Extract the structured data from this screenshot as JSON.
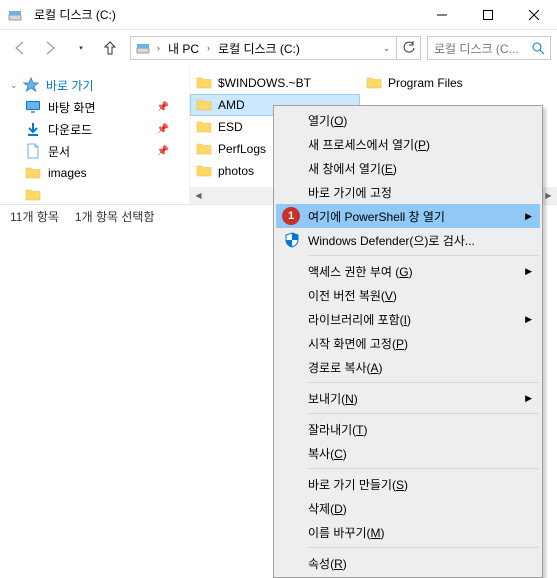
{
  "window": {
    "title": "로컬 디스크 (C:)"
  },
  "address": {
    "segment1": "내 PC",
    "segment2": "로컬 디스크 (C:)"
  },
  "search": {
    "placeholder": "로컬 디스크 (C..."
  },
  "sidebar": {
    "quick_access": "바로 가기",
    "items": [
      {
        "label": "바탕 화면",
        "pinned": true,
        "icon": "desktop"
      },
      {
        "label": "다운로드",
        "pinned": true,
        "icon": "downloads"
      },
      {
        "label": "문서",
        "pinned": true,
        "icon": "documents"
      },
      {
        "label": "images",
        "pinned": false,
        "icon": "folder"
      },
      {
        "label": "",
        "pinned": false,
        "icon": "folder"
      }
    ]
  },
  "files": {
    "col1": [
      {
        "name": "$WINDOWS.~BT",
        "selected": false
      },
      {
        "name": "AMD",
        "selected": true
      },
      {
        "name": "ESD",
        "selected": false
      },
      {
        "name": "PerfLogs",
        "selected": false
      },
      {
        "name": "photos",
        "selected": false
      }
    ],
    "col2": [
      {
        "name": "Program Files",
        "selected": false
      }
    ]
  },
  "status": {
    "count": "11개 항목",
    "selected": "1개 항목 선택함"
  },
  "context_menu": {
    "items": [
      {
        "label": "열기",
        "key": "O",
        "type": "item"
      },
      {
        "label": "새 프로세스에서 열기",
        "key": "P",
        "type": "item"
      },
      {
        "label": "새 창에서 열기",
        "key": "E",
        "type": "item"
      },
      {
        "label": "바로 가기에 고정",
        "key": "",
        "type": "item"
      },
      {
        "label": "여기에 PowerShell 창 열기",
        "key": "",
        "type": "item",
        "highlighted": true,
        "badge": "1",
        "submenu": true
      },
      {
        "label": "Windows Defender(으)로 검사...",
        "key": "",
        "type": "item",
        "icon": "shield"
      },
      {
        "type": "sep"
      },
      {
        "label": "액세스 권한 부여 ",
        "key": "G",
        "type": "item",
        "submenu": true
      },
      {
        "label": "이전 버전 복원",
        "key": "V",
        "type": "item"
      },
      {
        "label": "라이브러리에 포함",
        "key": "I",
        "type": "item",
        "submenu": true
      },
      {
        "label": "시작 화면에 고정",
        "key": "P",
        "type": "item"
      },
      {
        "label": "경로로 복사",
        "key": "A",
        "type": "item"
      },
      {
        "type": "sep"
      },
      {
        "label": "보내기",
        "key": "N",
        "type": "item",
        "submenu": true
      },
      {
        "type": "sep"
      },
      {
        "label": "잘라내기",
        "key": "T",
        "type": "item"
      },
      {
        "label": "복사",
        "key": "C",
        "type": "item"
      },
      {
        "type": "sep"
      },
      {
        "label": "바로 가기 만들기",
        "key": "S",
        "type": "item"
      },
      {
        "label": "삭제",
        "key": "D",
        "type": "item"
      },
      {
        "label": "이름 바꾸기",
        "key": "M",
        "type": "item"
      },
      {
        "type": "sep"
      },
      {
        "label": "속성",
        "key": "R",
        "type": "item"
      }
    ]
  }
}
